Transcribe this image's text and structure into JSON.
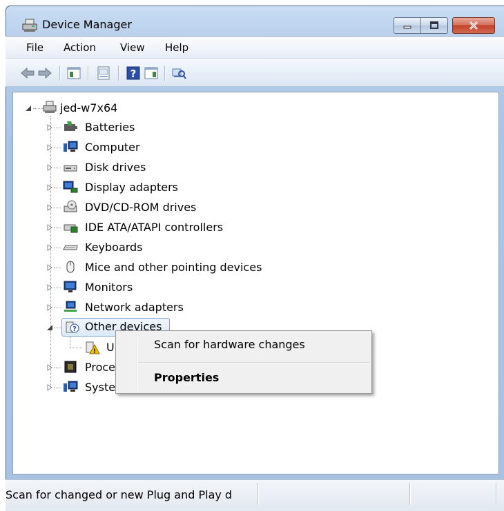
{
  "window": {
    "title": "Device Manager",
    "controls": {
      "minimize": "minimize",
      "maximize": "maximize",
      "close": "close"
    }
  },
  "menu": [
    "File",
    "Action",
    "View",
    "Help"
  ],
  "toolbar": {
    "buttons": [
      "back-icon",
      "forward-icon",
      "show-hide-console-tree-icon",
      "properties-icon",
      "help-icon",
      "show-action-pane-icon",
      "scan-hardware-icon"
    ]
  },
  "tree": {
    "root": "jed-w7x64",
    "categories": [
      {
        "label": "Batteries",
        "icon": "battery-icon",
        "expanded": false
      },
      {
        "label": "Computer",
        "icon": "computer-icon",
        "expanded": false
      },
      {
        "label": "Disk drives",
        "icon": "disk-drive-icon",
        "expanded": false
      },
      {
        "label": "Display adapters",
        "icon": "display-adapter-icon",
        "expanded": false
      },
      {
        "label": "DVD/CD-ROM drives",
        "icon": "dvd-drive-icon",
        "expanded": false
      },
      {
        "label": "IDE ATA/ATAPI controllers",
        "icon": "ide-controller-icon",
        "expanded": false
      },
      {
        "label": "Keyboards",
        "icon": "keyboard-icon",
        "expanded": false
      },
      {
        "label": "Mice and other pointing devices",
        "icon": "mouse-icon",
        "expanded": false
      },
      {
        "label": "Monitors",
        "icon": "monitor-icon",
        "expanded": false
      },
      {
        "label": "Network adapters",
        "icon": "network-adapter-icon",
        "expanded": false
      },
      {
        "label": "Other devices",
        "icon": "unknown-device-icon",
        "expanded": true,
        "selected": true,
        "children": [
          {
            "label": "U",
            "icon": "warning-device-icon"
          }
        ]
      },
      {
        "label": "Proce",
        "icon": "processor-icon",
        "expanded": false
      },
      {
        "label": "Syste",
        "icon": "system-devices-icon",
        "expanded": false
      }
    ]
  },
  "context_menu": {
    "items": [
      "Scan for hardware changes",
      "Properties"
    ],
    "default_item": "Properties"
  },
  "status_bar": {
    "text": "Scan for changed or new Plug and Play d"
  },
  "colors": {
    "accent_frame": "#a9c2e2",
    "selection_border": "#7da2ce",
    "close_button": "#c2402a"
  }
}
